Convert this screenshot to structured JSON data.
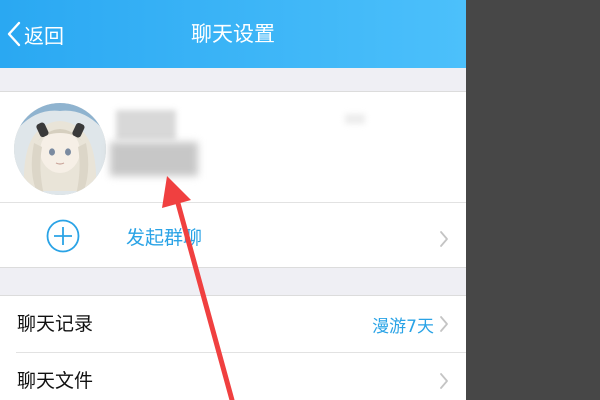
{
  "navbar": {
    "back_label": "返回",
    "title": "聊天设置",
    "icons": {
      "back": "chevron-left-icon"
    },
    "colors": {
      "start": "#2aa8f2",
      "end": "#4cc0fb"
    }
  },
  "profile": {
    "icons": {
      "avatar": "avatar-image",
      "chevron": "chevron-right-icon"
    }
  },
  "group_chat": {
    "label": "发起群聊",
    "icon": "plus-circle-icon",
    "color": "#2aa3e6"
  },
  "settings": {
    "items": [
      {
        "label": "聊天记录",
        "value": "漫游7天",
        "icon": "chevron-right-icon"
      },
      {
        "label": "聊天文件",
        "value": "",
        "icon": "chevron-right-icon"
      }
    ]
  },
  "annotation": {
    "color": "#f04040",
    "icon": "red-arrow-annotation"
  }
}
